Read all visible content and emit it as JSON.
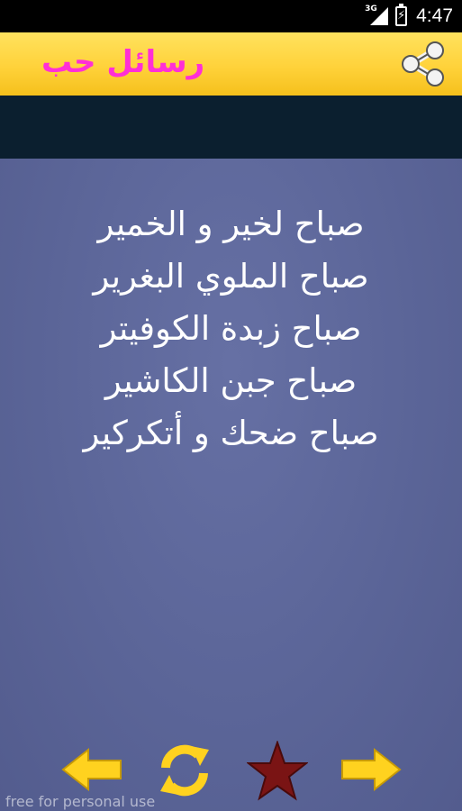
{
  "status_bar": {
    "network": "3G",
    "time": "4:47"
  },
  "header": {
    "title": "رسائل حب",
    "share_icon": "share-icon"
  },
  "message": {
    "lines": [
      "صباح لخير و الخمير",
      "صباح الملوي البغرير",
      "صباح زبدة الكوفيتر",
      "صباح جبن الكاشير",
      "صباح ضحك و أتكركير"
    ]
  },
  "bottom_nav": {
    "previous_icon": "arrow-left-icon",
    "refresh_icon": "refresh-icon",
    "favorite_icon": "star-icon",
    "next_icon": "arrow-right-icon"
  },
  "watermark": "free for personal use",
  "colors": {
    "header": "#ffd23a",
    "title": "#ff2fd6",
    "band": "#0b1f2f",
    "background": "#5b6598",
    "arrow": "#ffd21f",
    "star": "#7a1414"
  }
}
